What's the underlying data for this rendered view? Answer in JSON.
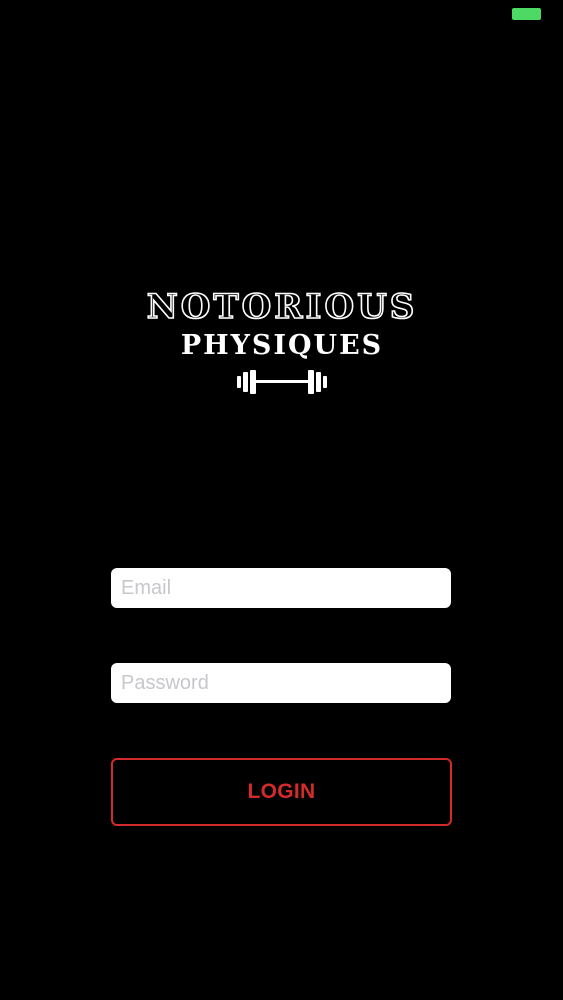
{
  "status_bar": {
    "battery_color": "#4cd964"
  },
  "brand": {
    "line1": "NOTORIOUS",
    "line2": "PHYSIQUES",
    "icon": "barbell-icon"
  },
  "login_form": {
    "email_placeholder": "Email",
    "email_value": "",
    "password_placeholder": "Password",
    "password_value": "",
    "login_label": "LOGIN"
  },
  "colors": {
    "background": "#000000",
    "accent": "#d42a2a",
    "field_background": "#ffffff",
    "placeholder": "#c7c7cc",
    "logo": "#ffffff"
  }
}
